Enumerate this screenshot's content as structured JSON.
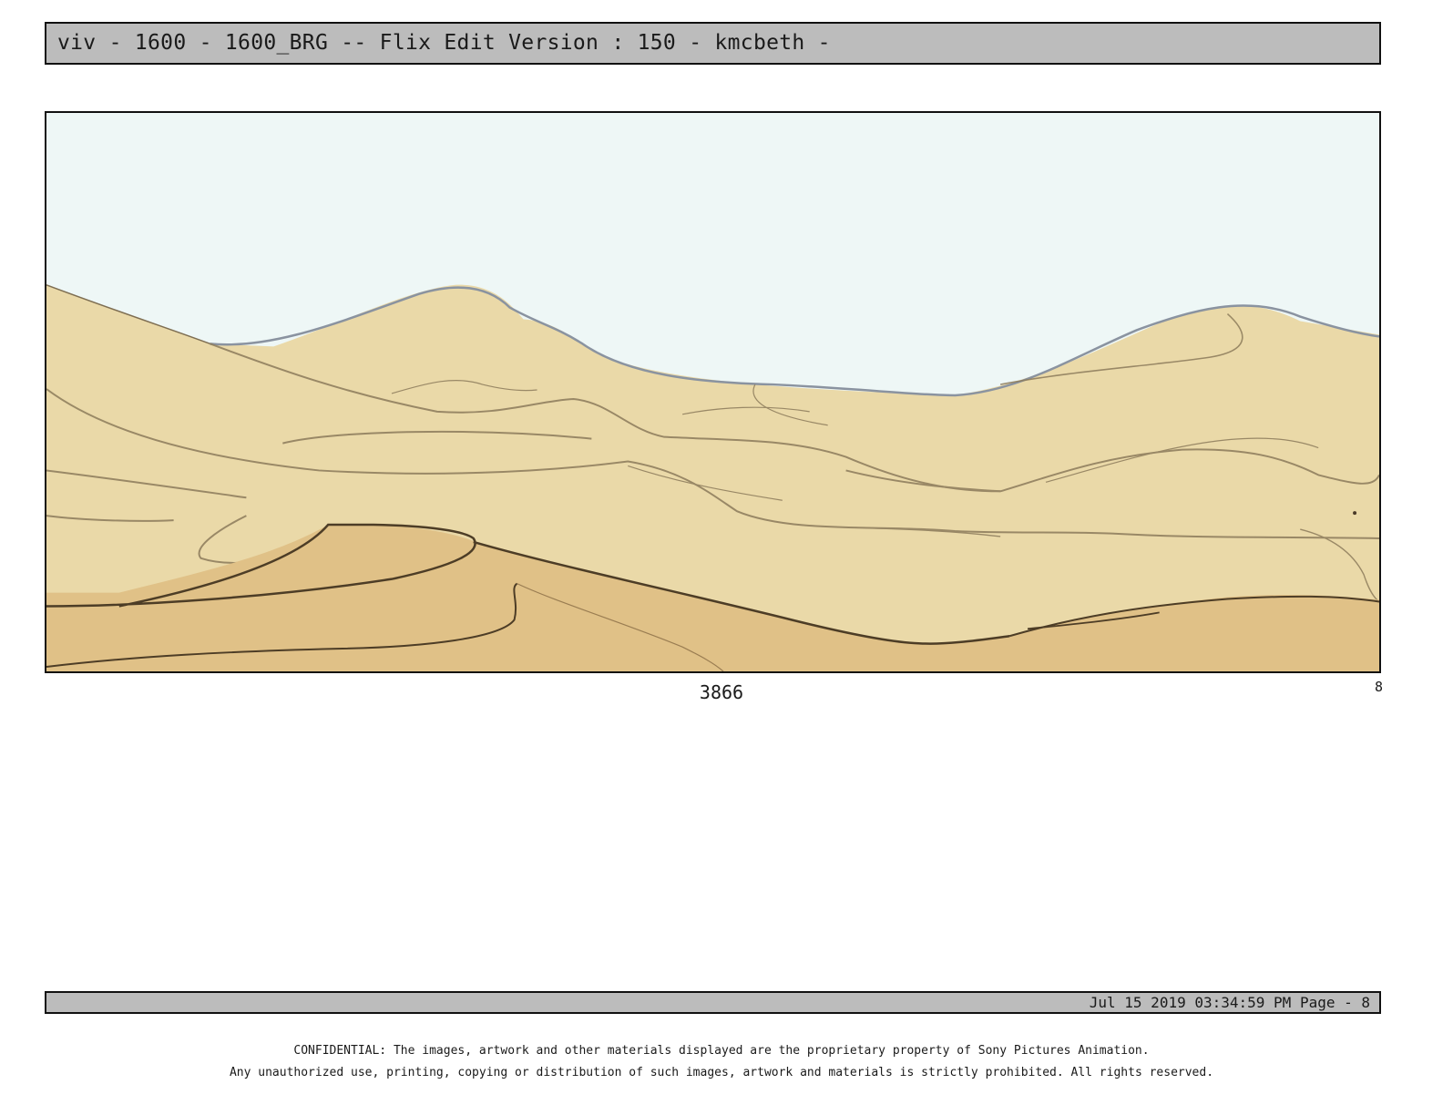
{
  "header": {
    "title": "viv - 1600 - 1600_BRG -- Flix Edit Version : 150 - kmcbeth -"
  },
  "panel": {
    "number": "3866",
    "page_mark": "8",
    "colors": {
      "sky": "#eef7f6",
      "dune_light": "#ead9a8",
      "dune_dark": "#e0c187",
      "line": "#5a4a32"
    }
  },
  "footer": {
    "timestamp_page": "Jul 15 2019 03:34:59 PM Page - 8"
  },
  "notice": {
    "line1": "CONFIDENTIAL: The images, artwork and other materials displayed are the proprietary property of Sony Pictures Animation.",
    "line2": "Any unauthorized use, printing, copying or distribution of such images, artwork and materials is strictly prohibited. All rights reserved."
  }
}
